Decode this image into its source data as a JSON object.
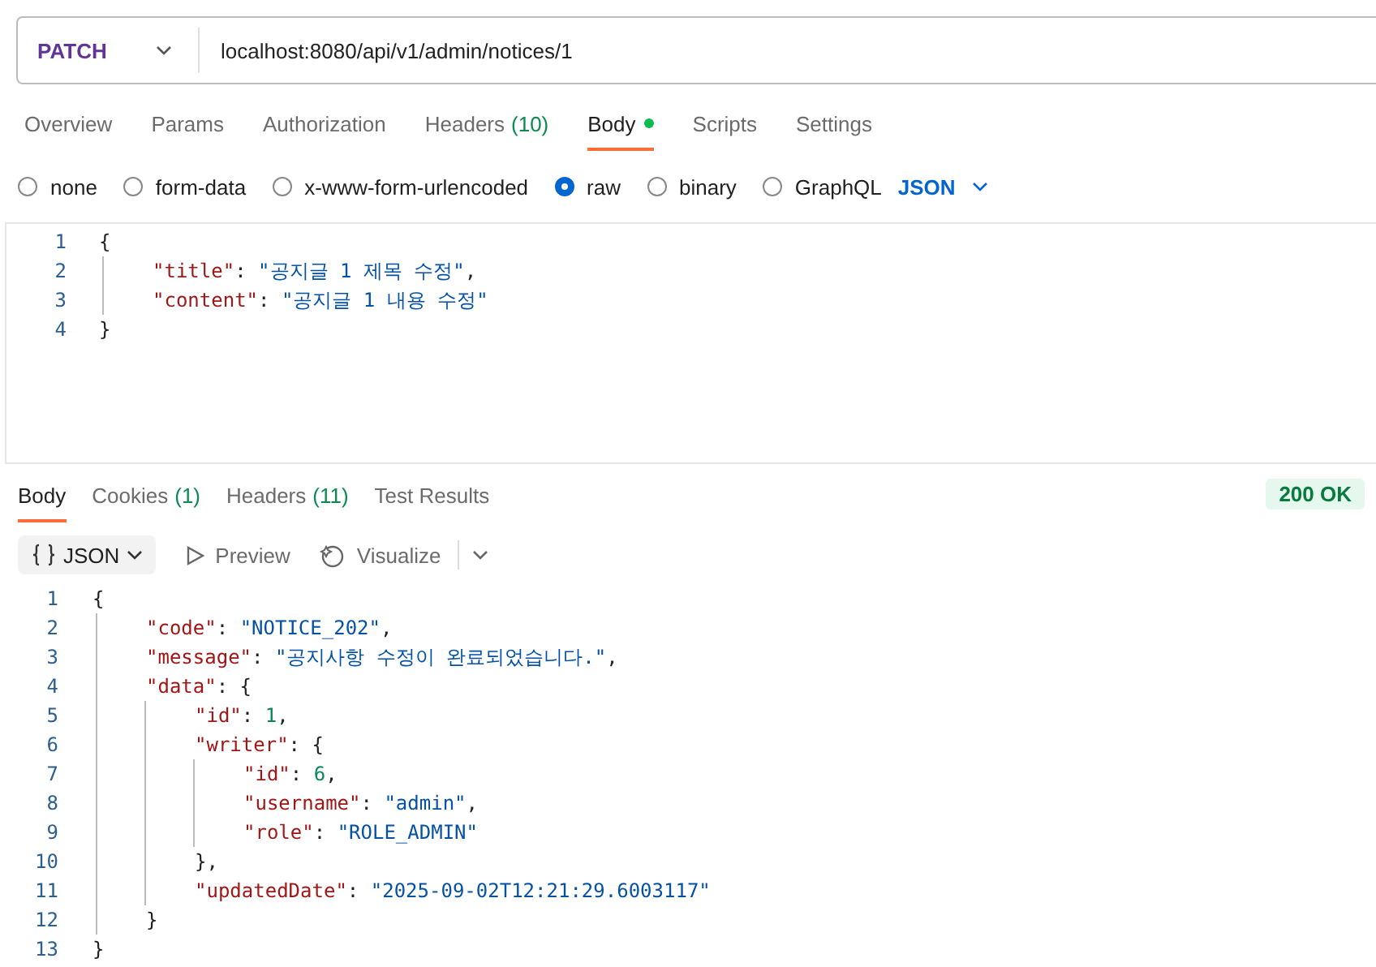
{
  "request": {
    "method": "PATCH",
    "url": "localhost:8080/api/v1/admin/notices/1"
  },
  "tabs": [
    {
      "label": "Overview",
      "selected": false
    },
    {
      "label": "Params",
      "selected": false
    },
    {
      "label": "Authorization",
      "selected": false
    },
    {
      "label": "Headers",
      "count": "(10)",
      "selected": false
    },
    {
      "label": "Body",
      "selected": true,
      "dot": true
    },
    {
      "label": "Scripts",
      "selected": false
    },
    {
      "label": "Settings",
      "selected": false
    }
  ],
  "body_types": [
    {
      "label": "none",
      "selected": false
    },
    {
      "label": "form-data",
      "selected": false
    },
    {
      "label": "x-www-form-urlencoded",
      "selected": false
    },
    {
      "label": "raw",
      "selected": true
    },
    {
      "label": "binary",
      "selected": false
    },
    {
      "label": "GraphQL",
      "selected": false
    }
  ],
  "format": "JSON",
  "request_body": [
    {
      "number": "1",
      "tokens": [
        {
          "kind": "punct",
          "text": "{"
        }
      ],
      "children": [
        {
          "number": "2",
          "tokens": [
            {
              "kind": "key",
              "text": "\"title\""
            },
            {
              "kind": "punct",
              "text": ": "
            },
            {
              "kind": "string",
              "text": "\"공지글 1 제목 수정\""
            },
            {
              "kind": "punct",
              "text": ","
            }
          ]
        },
        {
          "number": "3",
          "tokens": [
            {
              "kind": "key",
              "text": "\"content\""
            },
            {
              "kind": "punct",
              "text": ": "
            },
            {
              "kind": "string",
              "text": "\"공지글 1 내용 수정\""
            }
          ]
        }
      ]
    },
    {
      "number": "4",
      "tokens": [
        {
          "kind": "punct",
          "text": "}"
        }
      ]
    }
  ],
  "response_tabs": [
    {
      "label": "Body",
      "selected": true
    },
    {
      "label": "Cookies",
      "count": "(1)",
      "selected": false
    },
    {
      "label": "Headers",
      "count": "(11)",
      "selected": false
    },
    {
      "label": "Test Results",
      "selected": false
    }
  ],
  "status": "200 OK",
  "response_toolbar": {
    "format": "JSON",
    "preview": "Preview",
    "visualize": "Visualize"
  },
  "response_body": [
    {
      "number": "1",
      "tokens": [
        {
          "kind": "punct",
          "text": "{"
        }
      ],
      "children": [
        {
          "number": "2",
          "tokens": [
            {
              "kind": "key",
              "text": "\"code\""
            },
            {
              "kind": "punct",
              "text": ": "
            },
            {
              "kind": "string",
              "text": "\"NOTICE_202\""
            },
            {
              "kind": "punct",
              "text": ","
            }
          ]
        },
        {
          "number": "3",
          "tokens": [
            {
              "kind": "key",
              "text": "\"message\""
            },
            {
              "kind": "punct",
              "text": ": "
            },
            {
              "kind": "string",
              "text": "\"공지사항 수정이 완료되었습니다.\""
            },
            {
              "kind": "punct",
              "text": ","
            }
          ]
        },
        {
          "number": "4",
          "tokens": [
            {
              "kind": "key",
              "text": "\"data\""
            },
            {
              "kind": "punct",
              "text": ": {"
            }
          ],
          "children": [
            {
              "number": "5",
              "tokens": [
                {
                  "kind": "key",
                  "text": "\"id\""
                },
                {
                  "kind": "punct",
                  "text": ": "
                },
                {
                  "kind": "number",
                  "text": "1"
                },
                {
                  "kind": "punct",
                  "text": ","
                }
              ]
            },
            {
              "number": "6",
              "tokens": [
                {
                  "kind": "key",
                  "text": "\"writer\""
                },
                {
                  "kind": "punct",
                  "text": ": {"
                }
              ],
              "children": [
                {
                  "number": "7",
                  "tokens": [
                    {
                      "kind": "key",
                      "text": "\"id\""
                    },
                    {
                      "kind": "punct",
                      "text": ": "
                    },
                    {
                      "kind": "number",
                      "text": "6"
                    },
                    {
                      "kind": "punct",
                      "text": ","
                    }
                  ]
                },
                {
                  "number": "8",
                  "tokens": [
                    {
                      "kind": "key",
                      "text": "\"username\""
                    },
                    {
                      "kind": "punct",
                      "text": ": "
                    },
                    {
                      "kind": "string",
                      "text": "\"admin\""
                    },
                    {
                      "kind": "punct",
                      "text": ","
                    }
                  ]
                },
                {
                  "number": "9",
                  "tokens": [
                    {
                      "kind": "key",
                      "text": "\"role\""
                    },
                    {
                      "kind": "punct",
                      "text": ": "
                    },
                    {
                      "kind": "string",
                      "text": "\"ROLE_ADMIN\""
                    }
                  ]
                }
              ]
            },
            {
              "number": "10",
              "tokens": [
                {
                  "kind": "punct",
                  "text": "},"
                }
              ]
            },
            {
              "number": "11",
              "tokens": [
                {
                  "kind": "key",
                  "text": "\"updatedDate\""
                },
                {
                  "kind": "punct",
                  "text": ": "
                },
                {
                  "kind": "string",
                  "text": "\"2025-09-02T12:21:29.6003117\""
                }
              ]
            }
          ]
        },
        {
          "number": "12",
          "tokens": [
            {
              "kind": "punct",
              "text": "}"
            }
          ]
        }
      ]
    },
    {
      "number": "13",
      "tokens": [
        {
          "kind": "punct",
          "text": "}"
        }
      ]
    }
  ]
}
